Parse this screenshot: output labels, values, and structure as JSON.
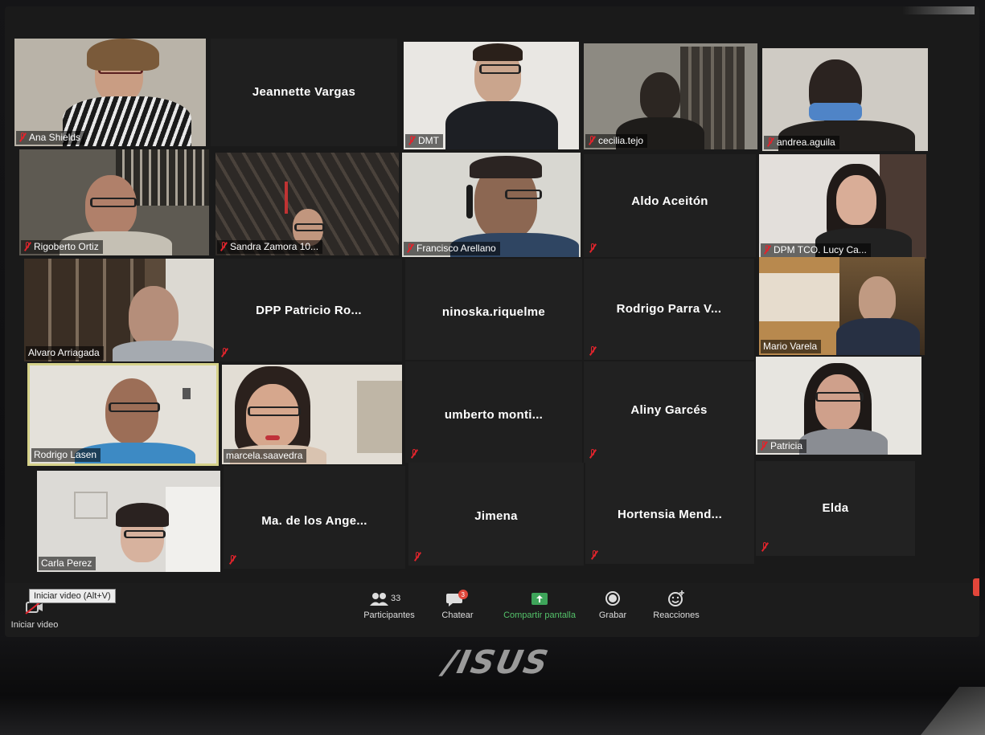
{
  "gallery": {
    "tiles": [
      {
        "name": "Ana Shields"
      },
      {
        "name": "Jeannette Vargas"
      },
      {
        "name": "DMT"
      },
      {
        "name": "cecilia.tejo"
      },
      {
        "name": "andrea.aguila"
      },
      {
        "name": "Rigoberto Ortiz"
      },
      {
        "name": "Sandra Zamora 10..."
      },
      {
        "name": "Francisco Arellano"
      },
      {
        "name": "Aldo Aceitón"
      },
      {
        "name": "DPM TCO. Lucy Ca..."
      },
      {
        "name": "Alvaro Arriagada"
      },
      {
        "name": "DPP Patricio Ro..."
      },
      {
        "name": "ninoska.riquelme"
      },
      {
        "name": "Rodrigo Parra V..."
      },
      {
        "name": "Mario Varela"
      },
      {
        "name": "Rodrigo Lasen"
      },
      {
        "name": "marcela.saavedra"
      },
      {
        "name": "umberto monti..."
      },
      {
        "name": "Aliny Garcés"
      },
      {
        "name": "Patricia"
      },
      {
        "name": "Carla Perez"
      },
      {
        "name": "Ma. de los Ange..."
      },
      {
        "name": "Jimena"
      },
      {
        "name": "Hortensia Mend..."
      },
      {
        "name": "Elda"
      }
    ]
  },
  "toolbar": {
    "video_label": "Iniciar video",
    "video_tooltip": "Iniciar video (Alt+V)",
    "participants_label": "Participantes",
    "participants_count": "33",
    "chat_label": "Chatear",
    "chat_badge": "3",
    "share_label": "Compartir pantalla",
    "record_label": "Grabar",
    "reactions_label": "Reacciones"
  },
  "device": {
    "brand_logo": "/ISUS"
  }
}
